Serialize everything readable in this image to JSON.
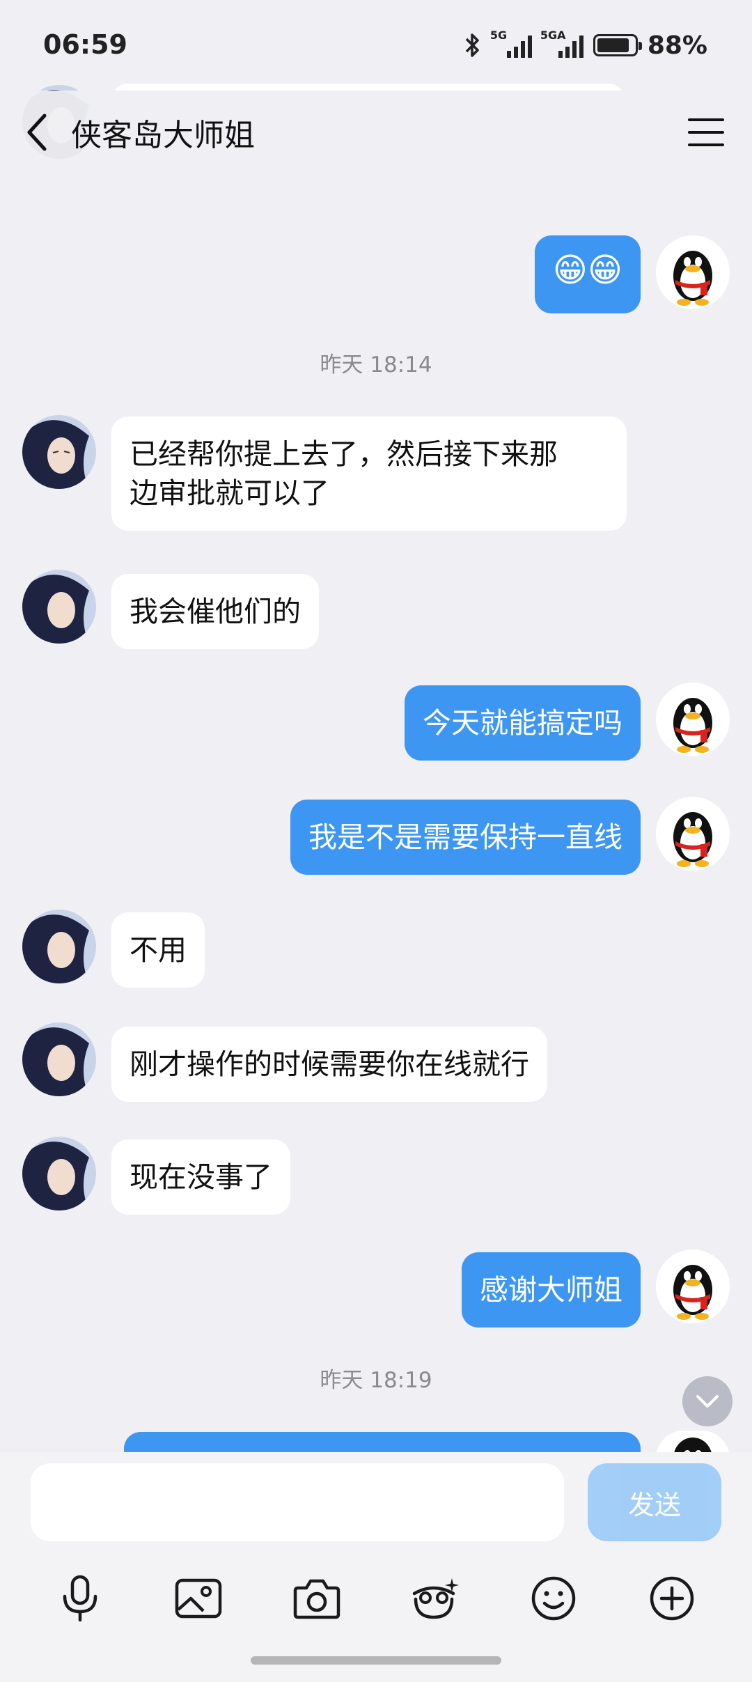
{
  "status_bar": {
    "time": "06:59",
    "battery": "88%",
    "signal1_label": "5G",
    "signal2_label": "5GA"
  },
  "header": {
    "title": "侠客岛大师姐"
  },
  "messages": [
    {
      "type": "out",
      "text": "😁😁"
    },
    {
      "type": "time",
      "text": "昨天 18:14"
    },
    {
      "type": "in",
      "line1": "已经帮你提上去了，然后接下来那",
      "line2": "边审批就可以了"
    },
    {
      "type": "in",
      "text": "我会催他们的"
    },
    {
      "type": "out",
      "text": "今天就能搞定吗"
    },
    {
      "type": "out",
      "text": "我是不是需要保持一直线"
    },
    {
      "type": "in",
      "text": "不用"
    },
    {
      "type": "in",
      "text": "刚才操作的时候需要你在线就行"
    },
    {
      "type": "in",
      "text": "现在没事了"
    },
    {
      "type": "out",
      "text": "感谢大师姐"
    },
    {
      "type": "time",
      "text": "昨天 18:19"
    }
  ],
  "input": {
    "value": "",
    "send_label": "发送"
  },
  "toolbar": {
    "icons": [
      "microphone-icon",
      "image-icon",
      "camera-icon",
      "sticker-icon",
      "emoji-icon",
      "plus-icon"
    ]
  },
  "colors": {
    "outgoing_bubble": "#3d96f2",
    "incoming_bubble": "#ffffff",
    "background": "#efeff4",
    "send_button": "#93c7f7"
  }
}
